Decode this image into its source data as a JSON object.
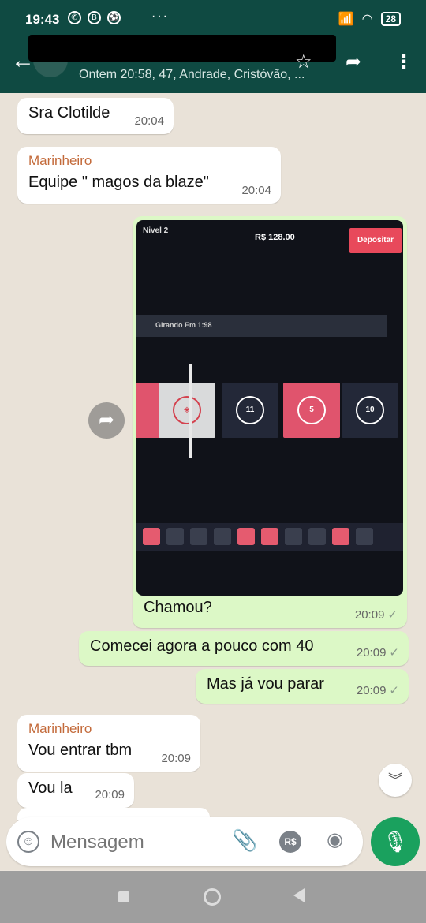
{
  "status_bar": {
    "time": "19:43",
    "left_icons": [
      "whatsapp-icon",
      "b-badge-icon",
      "soccer-icon",
      "voicemail-icon"
    ],
    "more": "···",
    "battery": "28",
    "right_icons": [
      "signal-icon",
      "signal2-icon",
      "wifi-icon",
      "battery-icon"
    ]
  },
  "header": {
    "subtitle": "Ontem 20:58, 47, Andrade, Cristóvão, ..."
  },
  "messages": [
    {
      "dir": "in",
      "text": "Sra Clotilde",
      "time": "20:04"
    },
    {
      "dir": "in",
      "sender": "Marinheiro",
      "text": "Equipe \" magos da blaze\"",
      "time": "20:04"
    },
    {
      "dir": "out",
      "type": "image",
      "caption": "Chamou?",
      "time": "20:09",
      "status": "✓"
    },
    {
      "dir": "out",
      "text": "Comecei agora a pouco com 40",
      "time": "20:09",
      "status": "✓"
    },
    {
      "dir": "out",
      "text": "Mas já vou parar",
      "time": "20:09",
      "status": "✓"
    },
    {
      "dir": "in",
      "sender": "Marinheiro",
      "text": "Vou entrar tbm",
      "time": "20:09"
    },
    {
      "dir": "in",
      "text": "Vou la",
      "time": "20:09"
    }
  ],
  "photo": {
    "level": "Nivel 2",
    "balance": "R$ 128.00",
    "deposit": "Depositar",
    "spin_label": "Girando Em 1:98",
    "tiles": [
      "",
      "",
      "11",
      "5",
      "10"
    ],
    "colors": {
      "red": "#e0546d",
      "white": "#d9dadb",
      "dark": "#232838"
    }
  },
  "composer": {
    "placeholder": "Mensagem",
    "currency_label": "R$"
  },
  "colors": {
    "header": "#0f4a42",
    "accent": "#1aa15e",
    "outgoing": "#dcf8c6"
  }
}
